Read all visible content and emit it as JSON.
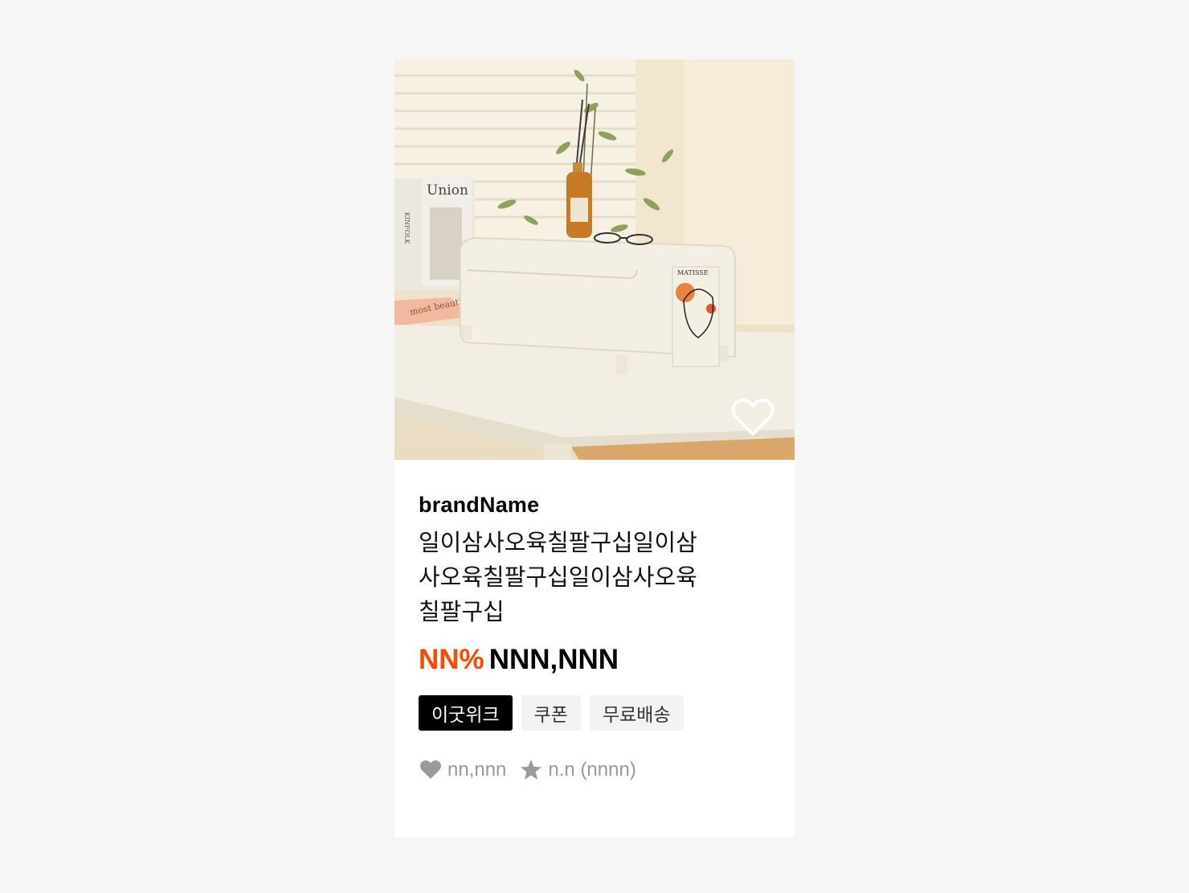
{
  "product": {
    "brand": "brandName",
    "title": "일이삼사오육칠팔구십일이삼사오육칠팔구십일이삼사오육칠팔구십",
    "discount": "NN%",
    "price": "NNN,NNN",
    "tags": [
      "이굿위크",
      "쿠폰",
      "무료배송"
    ],
    "likes": "nn,nnn",
    "rating": "n.n (nnnn)"
  },
  "photo": {
    "book_title": "Union",
    "book_spine": "KINFOLK",
    "magazine_text": "most beautiful",
    "poster_title": "MATISSE"
  },
  "colors": {
    "discount": "#ff4800",
    "tag_dark_bg": "#000000",
    "tag_light_bg": "#f3f3f3",
    "meta_text": "#9a9a9a"
  },
  "icons": [
    "heart-outline-icon",
    "heart-filled-icon",
    "star-icon"
  ]
}
